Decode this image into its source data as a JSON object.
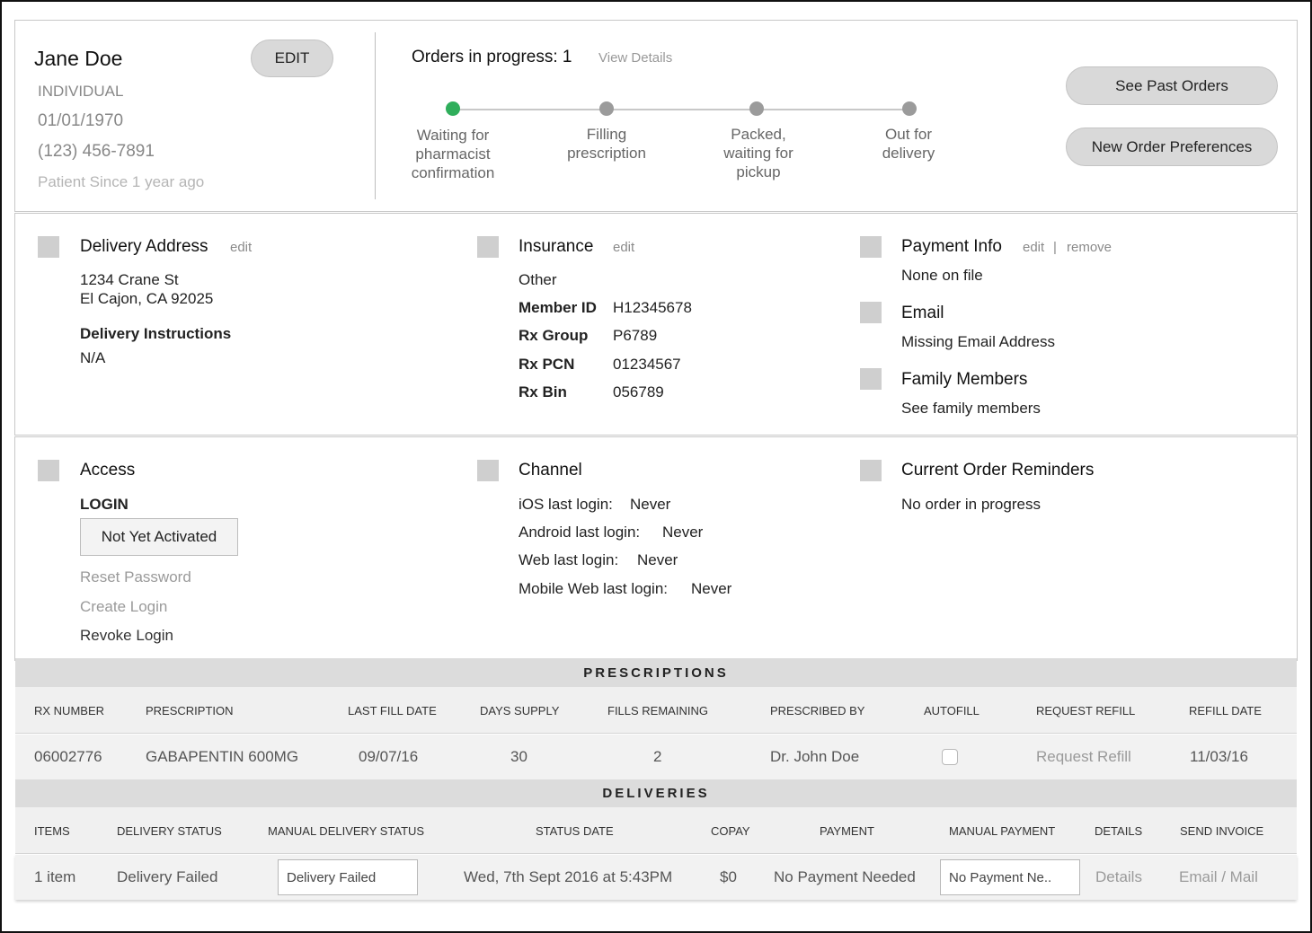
{
  "patient": {
    "name": "Jane Doe",
    "edit_label": "EDIT",
    "type": "INDIVIDUAL",
    "dob": "01/01/1970",
    "phone": "(123) 456-7891",
    "since": "Patient Since 1 year ago"
  },
  "orders": {
    "title": "Orders in progress: 1",
    "view_details": "View Details",
    "steps": [
      {
        "label": "Waiting for pharmacist confirmation",
        "active": true
      },
      {
        "label": "Filling prescription",
        "active": false
      },
      {
        "label": "Packed, waiting for pickup",
        "active": false
      },
      {
        "label": "Out for delivery",
        "active": false
      }
    ],
    "active_color": "#2fae5b",
    "past_orders_label": "See Past Orders",
    "preferences_label": "New Order Preferences"
  },
  "delivery": {
    "title": "Delivery Address",
    "edit": "edit",
    "address_line1": "1234 Crane St",
    "address_line2": "El Cajon, CA 92025",
    "instructions_label": "Delivery Instructions",
    "instructions_value": "N/A"
  },
  "insurance": {
    "title": "Insurance",
    "edit": "edit",
    "plan": "Other",
    "fields": [
      {
        "label": "Member ID",
        "value": "H12345678"
      },
      {
        "label": "Rx Group",
        "value": "P6789"
      },
      {
        "label": "Rx PCN",
        "value": "01234567"
      },
      {
        "label": "Rx Bin",
        "value": "056789"
      }
    ]
  },
  "payment": {
    "title": "Payment Info",
    "edit": "edit",
    "separator": "|",
    "remove": "remove",
    "value": "None on file"
  },
  "email": {
    "title": "Email",
    "value": "Missing Email Address"
  },
  "family": {
    "title": "Family Members",
    "value": "See family members"
  },
  "access": {
    "title": "Access",
    "login_label": "LOGIN",
    "status_button": "Not Yet Activated",
    "reset_password": "Reset Password",
    "create_login": "Create Login",
    "revoke_login": "Revoke Login"
  },
  "channel": {
    "title": "Channel",
    "items": [
      {
        "label": "iOS last login:",
        "value": "Never"
      },
      {
        "label": "Android last login:",
        "value": "Never"
      },
      {
        "label": "Web last login:",
        "value": "Never"
      },
      {
        "label": "Mobile Web last login:",
        "value": "Never"
      }
    ]
  },
  "reminders": {
    "title": "Current Order Reminders",
    "value": "No order in progress"
  },
  "prescriptions": {
    "title": "PRESCRIPTIONS",
    "headers": [
      "RX NUMBER",
      "PRESCRIPTION",
      "LAST FILL DATE",
      "DAYS SUPPLY",
      "FILLS REMAINING",
      "PRESCRIBED BY",
      "AUTOFILL",
      "REQUEST REFILL",
      "REFILL DATE"
    ],
    "rows": [
      {
        "rx_number": "06002776",
        "prescription": "GABAPENTIN 600MG",
        "last_fill": "09/07/16",
        "days_supply": "30",
        "fills_remaining": "2",
        "prescribed_by": "Dr. John Doe",
        "autofill": false,
        "request_refill": "Request Refill",
        "refill_date": "11/03/16"
      }
    ]
  },
  "deliveries": {
    "title": "DELIVERIES",
    "headers": [
      "ITEMS",
      "DELIVERY STATUS",
      "MANUAL DELIVERY STATUS",
      "STATUS DATE",
      "COPAY",
      "PAYMENT",
      "MANUAL PAYMENT",
      "DETAILS",
      "SEND INVOICE"
    ],
    "rows": [
      {
        "items": "1 item",
        "status": "Delivery Failed",
        "manual_status": "Delivery Failed",
        "status_date": "Wed, 7th Sept 2016 at 5:43PM",
        "copay": "$0",
        "payment": "No Payment Needed",
        "manual_payment": "No Payment Ne..",
        "details": "Details",
        "send_invoice": "Email / Mail"
      }
    ]
  }
}
